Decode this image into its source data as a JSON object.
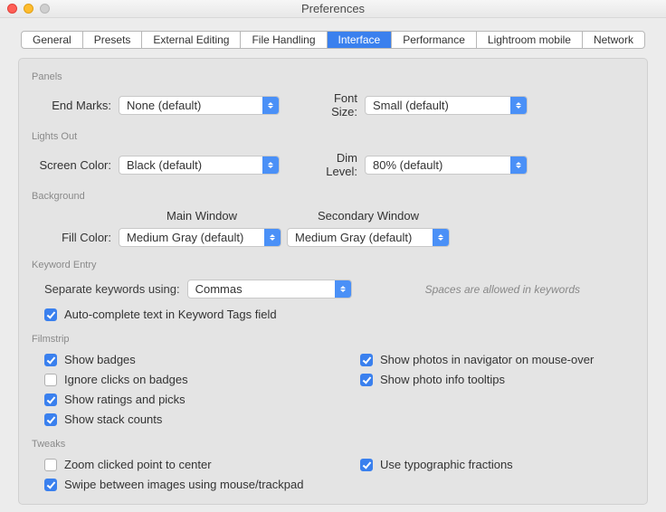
{
  "window": {
    "title": "Preferences"
  },
  "tabs": {
    "items": [
      {
        "label": "General"
      },
      {
        "label": "Presets"
      },
      {
        "label": "External Editing"
      },
      {
        "label": "File Handling"
      },
      {
        "label": "Interface",
        "selected": true
      },
      {
        "label": "Performance"
      },
      {
        "label": "Lightroom mobile"
      },
      {
        "label": "Network"
      }
    ]
  },
  "panels": {
    "title": "Panels",
    "end_marks_label": "End Marks:",
    "end_marks_value": "None (default)",
    "font_size_label": "Font Size:",
    "font_size_value": "Small (default)"
  },
  "lights_out": {
    "title": "Lights Out",
    "screen_color_label": "Screen Color:",
    "screen_color_value": "Black (default)",
    "dim_level_label": "Dim Level:",
    "dim_level_value": "80% (default)"
  },
  "background": {
    "title": "Background",
    "main_window_header": "Main Window",
    "secondary_window_header": "Secondary Window",
    "fill_color_label": "Fill Color:",
    "main_fill_value": "Medium Gray (default)",
    "secondary_fill_value": "Medium Gray (default)"
  },
  "keyword_entry": {
    "title": "Keyword Entry",
    "separate_label": "Separate keywords using:",
    "separate_value": "Commas",
    "note": "Spaces are allowed in keywords",
    "autocomplete_label": "Auto-complete text in Keyword Tags field",
    "autocomplete_checked": true
  },
  "filmstrip": {
    "title": "Filmstrip",
    "left": [
      {
        "label": "Show badges",
        "checked": true
      },
      {
        "label": "Ignore clicks on badges",
        "checked": false
      },
      {
        "label": "Show ratings and picks",
        "checked": true
      },
      {
        "label": "Show stack counts",
        "checked": true
      }
    ],
    "right": [
      {
        "label": "Show photos in navigator on mouse-over",
        "checked": true
      },
      {
        "label": "Show photo info tooltips",
        "checked": true
      }
    ]
  },
  "tweaks": {
    "title": "Tweaks",
    "left": [
      {
        "label": "Zoom clicked point to center",
        "checked": false
      },
      {
        "label": "Swipe between images using mouse/trackpad",
        "checked": true
      }
    ],
    "right": [
      {
        "label": "Use typographic fractions",
        "checked": true
      }
    ]
  }
}
